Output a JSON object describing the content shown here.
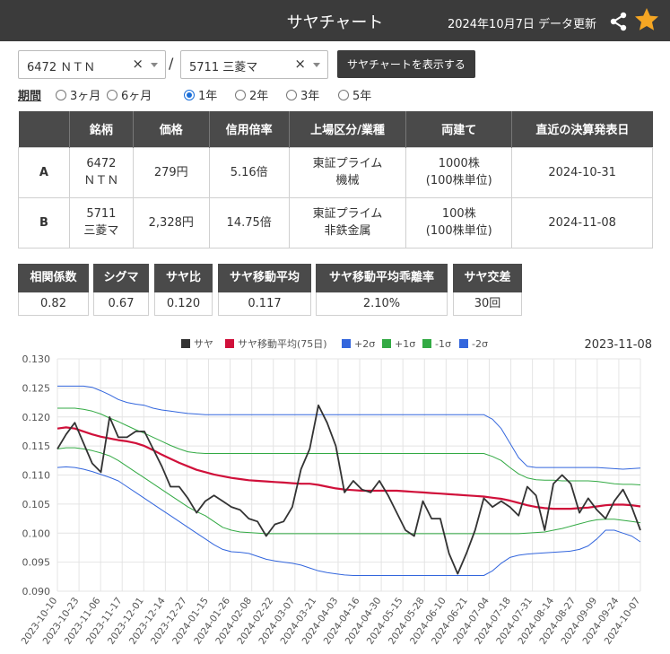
{
  "header": {
    "title": "サヤチャート",
    "updated": "2024年10月7日 データ更新"
  },
  "selectors": {
    "a_value": "6472 ＮＴＮ",
    "b_value": "5711 三菱マ",
    "clear": "×",
    "separator": "/",
    "show_button": "サヤチャートを表示する"
  },
  "period": {
    "label": "期間",
    "options": [
      "3ヶ月",
      "6ヶ月",
      "1年",
      "2年",
      "3年",
      "5年"
    ],
    "selected": "1年"
  },
  "table": {
    "headers": [
      "",
      "銘柄",
      "価格",
      "信用倍率",
      "上場区分/業種",
      "両建て",
      "直近の決算発表日"
    ],
    "rows": [
      {
        "id": "A",
        "code": "6472",
        "name": "ＮＴＮ",
        "price": "279円",
        "margin": "5.16倍",
        "market": "東証プライム",
        "sector": "機械",
        "hedge": "1000株",
        "unit": "(100株単位)",
        "earnings": "2024-10-31"
      },
      {
        "id": "B",
        "code": "5711",
        "name": "三菱マ",
        "price": "2,328円",
        "margin": "14.75倍",
        "market": "東証プライム",
        "sector": "非鉄金属",
        "hedge": "100株",
        "unit": "(100株単位)",
        "earnings": "2024-11-08"
      }
    ]
  },
  "stats": [
    {
      "label": "相関係数",
      "value": "0.82"
    },
    {
      "label": "シグマ",
      "value": "0.67"
    },
    {
      "label": "サヤ比",
      "value": "0.120"
    },
    {
      "label": "サヤ移動平均",
      "value": "0.117"
    },
    {
      "label": "サヤ移動平均乖離率",
      "value": "2.10%"
    },
    {
      "label": "サヤ交差",
      "value": "30回"
    }
  ],
  "chart_data": {
    "type": "line",
    "annotation": "2023-11-08",
    "ylim": [
      0.09,
      0.13
    ],
    "y_ticks": [
      "0.130",
      "0.125",
      "0.120",
      "0.115",
      "0.110",
      "0.105",
      "0.100",
      "0.095",
      "0.090"
    ],
    "x_ticks": [
      "2023-10-10",
      "2023-10-23",
      "2023-11-06",
      "2023-11-17",
      "2023-12-01",
      "2023-12-14",
      "2023-12-27",
      "2024-01-15",
      "2024-01-26",
      "2024-02-08",
      "2024-02-22",
      "2024-03-07",
      "2024-03-21",
      "2024-04-03",
      "2024-04-16",
      "2024-04-30",
      "2024-05-15",
      "2024-05-28",
      "2024-06-10",
      "2024-06-21",
      "2024-07-04",
      "2024-07-18",
      "2024-07-31",
      "2024-08-14",
      "2024-08-27",
      "2024-09-09",
      "2024-09-24",
      "2024-10-07"
    ],
    "grid": true,
    "legend_position": "top",
    "series": [
      {
        "name": "サヤ",
        "color": "#333333",
        "values": [
          0.1145,
          0.117,
          0.119,
          0.1155,
          0.112,
          0.1105,
          0.12,
          0.1165,
          0.1165,
          0.1175,
          0.1175,
          0.1145,
          0.1115,
          0.108,
          0.108,
          0.106,
          0.1035,
          0.1055,
          0.1065,
          0.1055,
          0.1045,
          0.104,
          0.1025,
          0.102,
          0.0995,
          0.1015,
          0.102,
          0.1045,
          0.111,
          0.1145,
          0.122,
          0.119,
          0.115,
          0.107,
          0.109,
          0.1075,
          0.107,
          0.109,
          0.1065,
          0.1035,
          0.1005,
          0.0995,
          0.1055,
          0.1025,
          0.1025,
          0.0965,
          0.093,
          0.0965,
          0.1005,
          0.106,
          0.1045,
          0.1055,
          0.1045,
          0.103,
          0.108,
          0.1065,
          0.1005,
          0.1085,
          0.11,
          0.1085,
          0.1035,
          0.106,
          0.104,
          0.1025,
          0.1055,
          0.1075,
          0.1045,
          0.1005
        ]
      },
      {
        "name": "サヤ移動平均(75日)",
        "color": "#d0103a",
        "values": [
          0.118,
          0.1182,
          0.118,
          0.1175,
          0.117,
          0.1166,
          0.1163,
          0.116,
          0.1158,
          0.1155,
          0.115,
          0.1143,
          0.1135,
          0.1128,
          0.1121,
          0.1115,
          0.1109,
          0.1105,
          0.1101,
          0.1098,
          0.1095,
          0.1093,
          0.1091,
          0.109,
          0.1089,
          0.1088,
          0.1087,
          0.1086,
          0.1085,
          0.1085,
          0.1083,
          0.108,
          0.1077,
          0.1075,
          0.1074,
          0.1073,
          0.1073,
          0.1073,
          0.1073,
          0.1073,
          0.1072,
          0.1071,
          0.107,
          0.1069,
          0.1068,
          0.1067,
          0.1066,
          0.1065,
          0.1064,
          0.1063,
          0.1061,
          0.1059,
          0.1056,
          0.1052,
          0.1048,
          0.1045,
          0.1043,
          0.1042,
          0.1042,
          0.1042,
          0.1043,
          0.1044,
          0.1046,
          0.1048,
          0.1049,
          0.1049,
          0.1048,
          0.1046
        ]
      },
      {
        "name": "+2σ",
        "color": "#3366dd",
        "values": [
          0.1253,
          0.1253,
          0.1253,
          0.1253,
          0.1251,
          0.1245,
          0.1238,
          0.123,
          0.1225,
          0.1222,
          0.122,
          0.1215,
          0.1212,
          0.121,
          0.1208,
          0.1206,
          0.1205,
          0.1204,
          0.1204,
          0.1204,
          0.1204,
          0.1204,
          0.1204,
          0.1204,
          0.1204,
          0.1204,
          0.1204,
          0.1204,
          0.1204,
          0.1204,
          0.1204,
          0.1204,
          0.1204,
          0.1204,
          0.1204,
          0.1204,
          0.1204,
          0.1204,
          0.1204,
          0.1204,
          0.1204,
          0.1204,
          0.1204,
          0.1204,
          0.1204,
          0.1204,
          0.1204,
          0.1204,
          0.1204,
          0.1204,
          0.1196,
          0.118,
          0.1155,
          0.113,
          0.1115,
          0.1113,
          0.1113,
          0.1113,
          0.1113,
          0.1113,
          0.1113,
          0.1113,
          0.1113,
          0.1112,
          0.1111,
          0.111,
          0.1111,
          0.1112
        ]
      },
      {
        "name": "+1σ",
        "color": "#33aa44",
        "values": [
          0.1215,
          0.1215,
          0.1215,
          0.1213,
          0.121,
          0.1205,
          0.1198,
          0.1192,
          0.1185,
          0.1178,
          0.1172,
          0.1165,
          0.1158,
          0.1151,
          0.1145,
          0.114,
          0.1138,
          0.1137,
          0.1137,
          0.1137,
          0.1137,
          0.1137,
          0.1137,
          0.1137,
          0.1137,
          0.1137,
          0.1137,
          0.1137,
          0.1137,
          0.1137,
          0.1137,
          0.1137,
          0.1137,
          0.1137,
          0.1137,
          0.1137,
          0.1137,
          0.1137,
          0.1137,
          0.1137,
          0.1137,
          0.1137,
          0.1137,
          0.1137,
          0.1137,
          0.1137,
          0.1137,
          0.1137,
          0.1137,
          0.1137,
          0.1132,
          0.1125,
          0.1113,
          0.1102,
          0.1095,
          0.1092,
          0.1091,
          0.1091,
          0.109,
          0.109,
          0.109,
          0.109,
          0.1089,
          0.1087,
          0.1085,
          0.1084,
          0.1084,
          0.1083
        ]
      },
      {
        "name": "-1σ",
        "color": "#33aa44",
        "values": [
          0.1145,
          0.1147,
          0.1147,
          0.1145,
          0.1142,
          0.1138,
          0.1133,
          0.1125,
          0.1115,
          0.1105,
          0.1095,
          0.1085,
          0.1075,
          0.1065,
          0.1055,
          0.1045,
          0.1037,
          0.103,
          0.102,
          0.101,
          0.1005,
          0.1002,
          0.1001,
          0.1,
          0.0999,
          0.0999,
          0.0999,
          0.0999,
          0.0999,
          0.0999,
          0.0999,
          0.0999,
          0.0999,
          0.0999,
          0.0999,
          0.0999,
          0.0999,
          0.0999,
          0.0999,
          0.0999,
          0.0999,
          0.0999,
          0.0999,
          0.0999,
          0.0999,
          0.0999,
          0.0999,
          0.0999,
          0.0999,
          0.0999,
          0.0999,
          0.0999,
          0.0999,
          0.0999,
          0.1,
          0.1001,
          0.1002,
          0.1005,
          0.1008,
          0.1012,
          0.1016,
          0.102,
          0.1023,
          0.1024,
          0.1024,
          0.1022,
          0.102,
          0.1018
        ]
      },
      {
        "name": "-2σ",
        "color": "#3366dd",
        "values": [
          0.1113,
          0.1114,
          0.1113,
          0.111,
          0.1106,
          0.1101,
          0.1096,
          0.109,
          0.108,
          0.107,
          0.106,
          0.105,
          0.104,
          0.103,
          0.102,
          0.101,
          0.1,
          0.099,
          0.098,
          0.0972,
          0.0968,
          0.0967,
          0.0965,
          0.096,
          0.0955,
          0.0952,
          0.095,
          0.0948,
          0.0945,
          0.094,
          0.0935,
          0.0932,
          0.093,
          0.0928,
          0.0927,
          0.0927,
          0.0927,
          0.0927,
          0.0927,
          0.0927,
          0.0927,
          0.0927,
          0.0927,
          0.0927,
          0.0927,
          0.0927,
          0.0927,
          0.0927,
          0.0927,
          0.0927,
          0.0935,
          0.0948,
          0.0958,
          0.0962,
          0.0964,
          0.0965,
          0.0966,
          0.0967,
          0.0968,
          0.0969,
          0.0972,
          0.0978,
          0.099,
          0.1005,
          0.1005,
          0.1,
          0.0995,
          0.0985
        ]
      }
    ]
  }
}
